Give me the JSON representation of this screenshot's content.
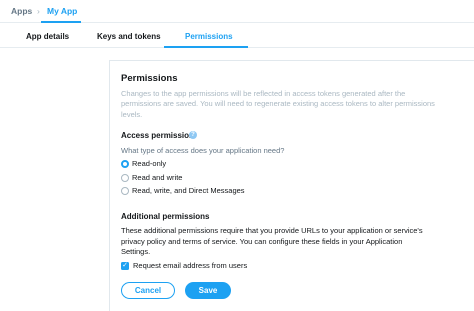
{
  "breadcrumb": {
    "apps": "Apps",
    "separator": "›",
    "current": "My App"
  },
  "tabs": [
    {
      "label": "App details",
      "active": false
    },
    {
      "label": "Keys and tokens",
      "active": false
    },
    {
      "label": "Permissions",
      "active": true
    }
  ],
  "permissions": {
    "title": "Permissions",
    "description": "Changes to the app permissions will be reflected in access tokens generated after the permissions are saved. You will need to regenerate existing access tokens to alter permissions levels.",
    "access": {
      "heading": "Access permission",
      "info_icon": "?",
      "question": "What type of access does your application need?",
      "options": [
        {
          "label": "Read-only",
          "selected": true
        },
        {
          "label": "Read and write",
          "selected": false
        },
        {
          "label": "Read, write, and Direct Messages",
          "selected": false
        }
      ]
    },
    "additional": {
      "heading": "Additional permissions",
      "description": "These additional permissions require that you provide URLs to your application or service's privacy policy and terms of service. You can configure these fields in your Application Settings.",
      "email_label": "Request email address from users",
      "email_checked": true,
      "checkmark": "✓"
    }
  },
  "buttons": {
    "cancel": "Cancel",
    "save": "Save"
  },
  "colors": {
    "accent": "#1da1f2",
    "muted_text": "#aab8c2",
    "secondary_text": "#657786"
  }
}
